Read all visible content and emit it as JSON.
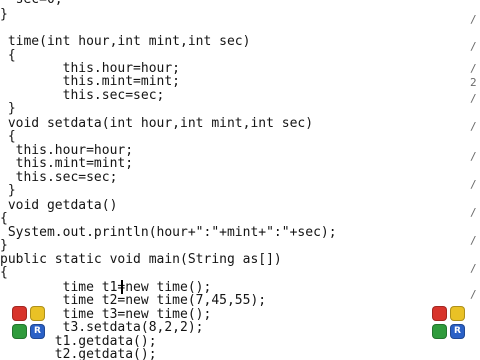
{
  "editor": {
    "lines": [
      {
        "text": "  sec=0;"
      },
      {
        "text": "}"
      },
      {
        "text": " time(int hour,int mint,int sec)"
      },
      {
        "text": " {"
      },
      {
        "text": "        this.hour=hour;"
      },
      {
        "text": "        this.mint=mint;"
      },
      {
        "text": "        this.sec=sec;"
      },
      {
        "text": " }"
      },
      {
        "text": " void setdata(int hour,int mint,int sec)"
      },
      {
        "text": " {"
      },
      {
        "text": "  this.hour=hour;"
      },
      {
        "text": "  this.mint=mint;"
      },
      {
        "text": "  this.sec=sec;"
      },
      {
        "text": " }"
      },
      {
        "text": " void getdata()"
      },
      {
        "text": "{"
      },
      {
        "text": " System.out.println(hour+\":\"+mint+\":\"+sec);"
      },
      {
        "text": "}"
      },
      {
        "text": "public static void main(String as[])"
      },
      {
        "text": "{"
      },
      {
        "text": "        time t1=new time();"
      },
      {
        "text": "        time t2=new time(7,45,55);"
      },
      {
        "text": "        time t3=new time();"
      },
      {
        "text": "        t3.setdata(8,2,2);"
      },
      {
        "text": "       t1.getdata();"
      },
      {
        "text": "       t2.getdata();"
      }
    ],
    "margin_marks": [
      "/",
      "/",
      "/",
      "2",
      "/",
      "/",
      "/",
      "/",
      "/",
      "/",
      "/",
      "/"
    ]
  },
  "taskbar": {
    "left_cluster": {
      "labels": [
        "",
        "",
        "",
        "R"
      ]
    },
    "right_cluster": {
      "labels": [
        "",
        "",
        "",
        "R"
      ]
    }
  },
  "colors": {
    "red": "#d8342c",
    "yellow": "#e9c125",
    "green": "#2f9b3c",
    "blue": "#2a60c6"
  }
}
